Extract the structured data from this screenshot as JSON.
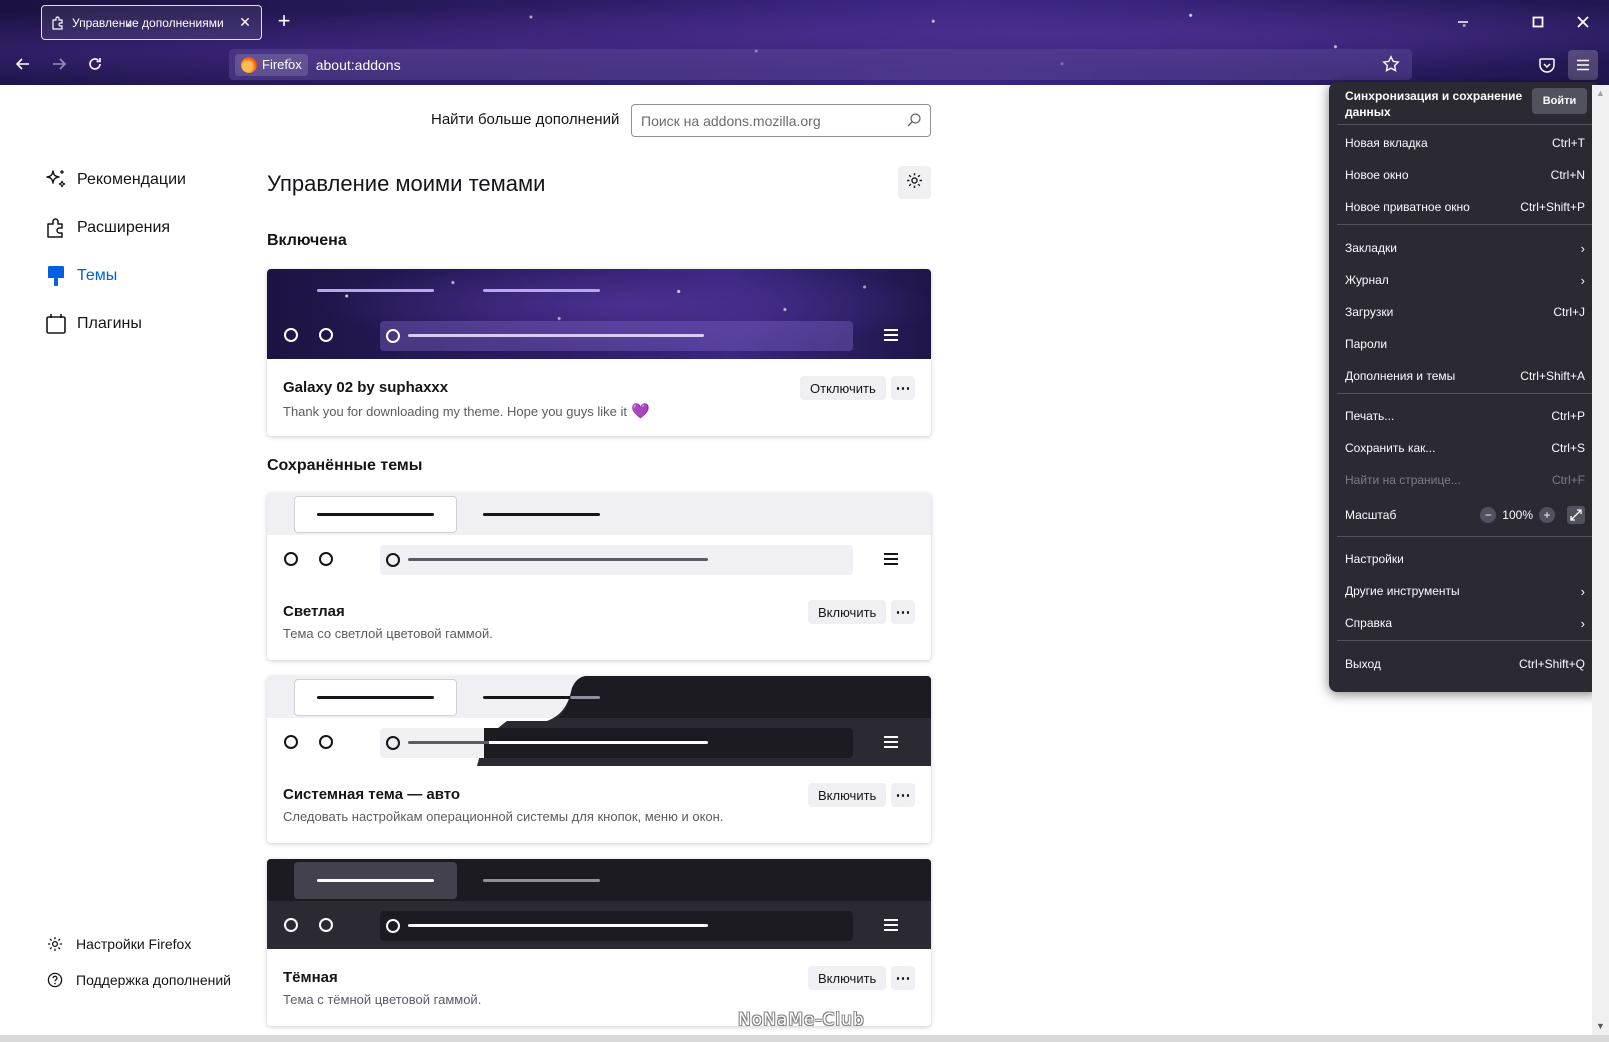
{
  "window": {
    "tab_title": "Управление дополнениями"
  },
  "urlbar": {
    "identity_label": "Firefox",
    "url": "about:addons"
  },
  "sidebar": {
    "categories": [
      {
        "label": "Рекомендации",
        "icon": "sparkle-icon"
      },
      {
        "label": "Расширения",
        "icon": "puzzle-icon"
      },
      {
        "label": "Темы",
        "icon": "paintbrush-icon",
        "active": true
      },
      {
        "label": "Плагины",
        "icon": "plugin-icon"
      }
    ],
    "footer": {
      "settings_label": "Настройки Firefox",
      "support_label": "Поддержка дополнений"
    }
  },
  "search": {
    "label": "Найти больше дополнений",
    "placeholder": "Поиск на addons.mozilla.org"
  },
  "main": {
    "title": "Управление моими темами",
    "enabled_heading": "Включена",
    "saved_heading": "Сохранённые темы"
  },
  "themes": [
    {
      "name": "Galaxy 02 by suphaxxx",
      "description": "Thank you for downloading my theme. Hope you guys like it",
      "button": "Отключить",
      "more": "⋯",
      "enabled": true
    },
    {
      "name": "Светлая",
      "description": "Тема со светлой цветовой гаммой.",
      "button": "Включить",
      "more": "⋯"
    },
    {
      "name": "Системная тема — авто",
      "description": "Следовать настройкам операционной системы для кнопок, меню и окон.",
      "button": "Включить",
      "more": "⋯"
    },
    {
      "name": "Тёмная",
      "description": "Тема с тёмной цветовой гаммой.",
      "button": "Включить",
      "more": "⋯"
    }
  ],
  "app_menu": {
    "sync_text": "Синхронизация и сохранение данных",
    "signin": "Войти",
    "items": [
      {
        "label": "Новая вкладка",
        "shortcut": "Ctrl+T"
      },
      {
        "label": "Новое окно",
        "shortcut": "Ctrl+N"
      },
      {
        "label": "Новое приватное окно",
        "shortcut": "Ctrl+Shift+P"
      },
      {
        "label": "Закладки",
        "shortcut": "›"
      },
      {
        "label": "Журнал",
        "shortcut": "›"
      },
      {
        "label": "Загрузки",
        "shortcut": "Ctrl+J"
      },
      {
        "label": "Пароли",
        "shortcut": ""
      },
      {
        "label": "Дополнения и темы",
        "shortcut": "Ctrl+Shift+A"
      },
      {
        "label": "Печать...",
        "shortcut": "Ctrl+P"
      },
      {
        "label": "Сохранить как...",
        "shortcut": "Ctrl+S"
      },
      {
        "label": "Найти на странице...",
        "shortcut": "Ctrl+F",
        "disabled": true
      },
      {
        "label": "Масштаб",
        "shortcut": ""
      },
      {
        "label": "Настройки",
        "shortcut": ""
      },
      {
        "label": "Другие инструменты",
        "shortcut": "›"
      },
      {
        "label": "Справка",
        "shortcut": "›"
      },
      {
        "label": "Выход",
        "shortcut": "Ctrl+Shift+Q"
      }
    ],
    "zoom_value": "100%",
    "zoom_minus": "−",
    "zoom_plus": "+"
  },
  "watermark": "NoNaMe-Club",
  "colors": {
    "accent": "#0061e0",
    "menu_bg": "#2b2a33",
    "galaxy_purple": "#3b2684"
  }
}
